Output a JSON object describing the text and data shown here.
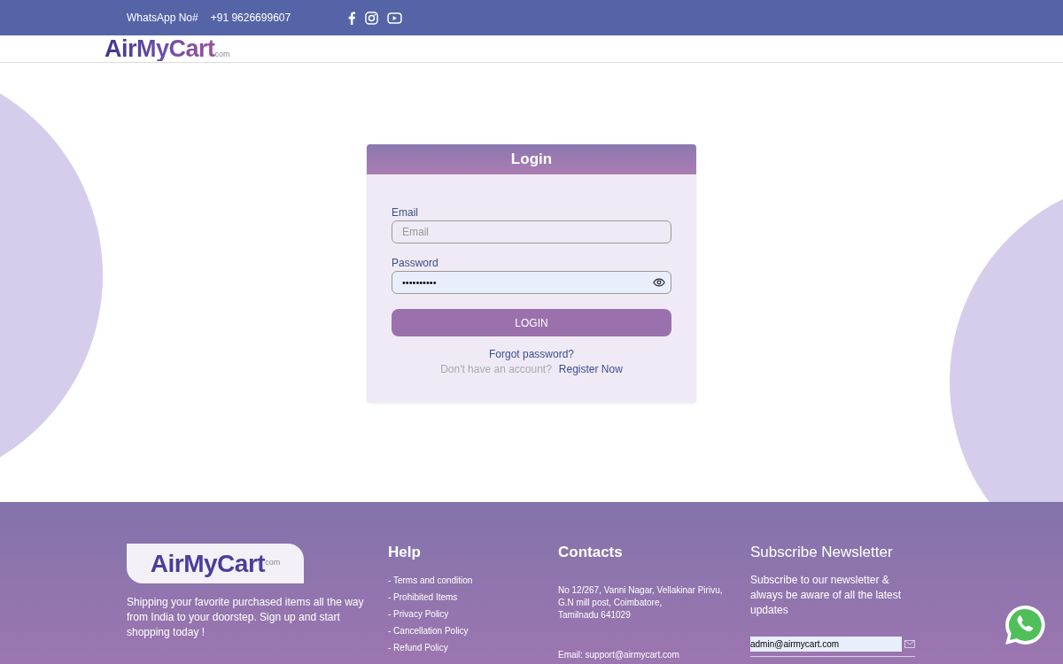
{
  "topbar": {
    "whatsapp_label": "WhatsApp No#",
    "phone": "+91 9626699607"
  },
  "header": {
    "logo": "AirMyCart",
    "logo_suffix": "com"
  },
  "login": {
    "title": "Login",
    "email": {
      "label": "Email",
      "placeholder": "Email"
    },
    "password": {
      "label": "Password",
      "value": "••••••••••"
    },
    "button": "LOGIN",
    "forgot": "Forgot password?",
    "no_account": "Don't have an account?",
    "register": "Register Now"
  },
  "footer": {
    "logo": "AirMyCart",
    "logo_suffix": "com",
    "about": "Shipping your favorite purchased items all the way from India to your doorstep. Sign up and start shopping today !",
    "help": {
      "title": "Help",
      "links": [
        "- Terms and condition",
        "- Prohibited Items",
        "- Privacy Policy",
        "- Cancellation Policy",
        "- Refund Policy"
      ]
    },
    "contacts": {
      "title": "Contacts",
      "address": [
        "No 12/267, Vanni Nagar, Vellakinar Pirivu,",
        "G.N mill post, Coimbatore,",
        "Tamilnadu 641029"
      ],
      "email": "Email: support@airmycart.com"
    },
    "newsletter": {
      "title": "Subscribe Newsletter",
      "text": "Subscribe to our newsletter & always be aware of all the latest updates",
      "value": "admin@airmycart.com"
    }
  }
}
